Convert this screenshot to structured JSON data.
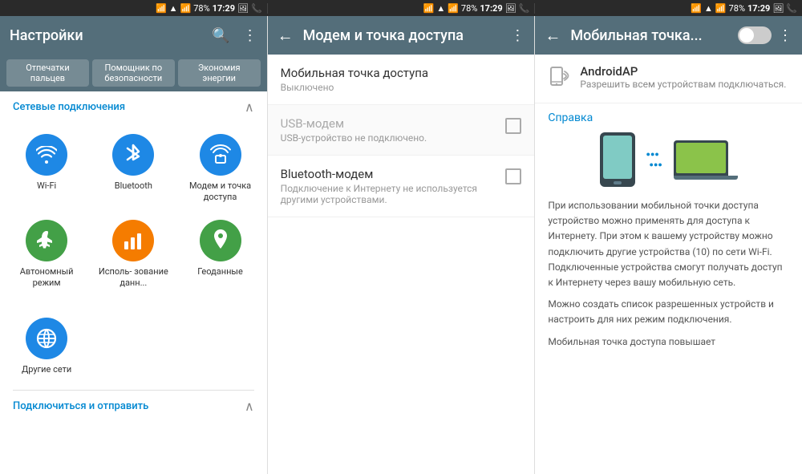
{
  "statusBar": {
    "icons": [
      "sim",
      "wifi",
      "signal",
      "78%",
      "17:29",
      "photo",
      "phone"
    ],
    "battery": "78%",
    "time": "17:29"
  },
  "panel1": {
    "title": "Настройки",
    "shortcuts": [
      {
        "label": "Отпечатки\nпальцев"
      },
      {
        "label": "Помощник по\nбезопасности"
      },
      {
        "label": "Экономия\nэнергии"
      }
    ],
    "networkSection": {
      "title": "Сетевые подключения",
      "items": [
        {
          "label": "Wi-Fi",
          "icon": "wifi",
          "color": "bg-blue"
        },
        {
          "label": "Bluetooth",
          "icon": "bluetooth",
          "color": "bg-blue"
        },
        {
          "label": "Модем и точка\nдоступа",
          "icon": "hotspot",
          "color": "bg-blue"
        },
        {
          "label": "Автономный\nрежим",
          "icon": "airplane",
          "color": "bg-green"
        },
        {
          "label": "Исполь-\nзование данн...",
          "icon": "chart",
          "color": "bg-orange"
        },
        {
          "label": "Геоданные",
          "icon": "location",
          "color": "bg-green"
        },
        {
          "label": "Другие сети",
          "icon": "network",
          "color": "bg-blue"
        }
      ]
    },
    "connectSection": {
      "title": "Подключиться и отправить"
    }
  },
  "panel2": {
    "title": "Модем и точка доступа",
    "items": [
      {
        "title": "Мобильная точка доступа",
        "subtitle": "Выключено",
        "hasCheckbox": false,
        "disabled": false
      },
      {
        "title": "USB-модем",
        "subtitle": "USB-устройство не подключено.",
        "hasCheckbox": true,
        "checked": false,
        "disabled": true
      },
      {
        "title": "Bluetooth-модем",
        "subtitle": "Подключение к Интернету не используется\nдругими устройствами.",
        "hasCheckbox": true,
        "checked": false,
        "disabled": false
      }
    ]
  },
  "panel3": {
    "title": "Мобильная точка...",
    "toggleOn": false,
    "androidAP": {
      "name": "AndroidAP",
      "subtitle": "Разрешить всем устройствам подключаться.",
      "icon": "📱"
    },
    "help": {
      "title": "Справка",
      "paragraphs": [
        "При использовании мобильной точки доступа устройство можно применять для доступа к Интернету. При этом к вашему устройству можно подключить другие устройства (10) по сети Wi-Fi. Подключенные устройства смогут получать доступ к Интернету через вашу мобильную сеть.",
        "Можно создать список разрешенных устройств и настроить для них режим подключения.",
        "Мобильная точка доступа повышает"
      ]
    }
  }
}
